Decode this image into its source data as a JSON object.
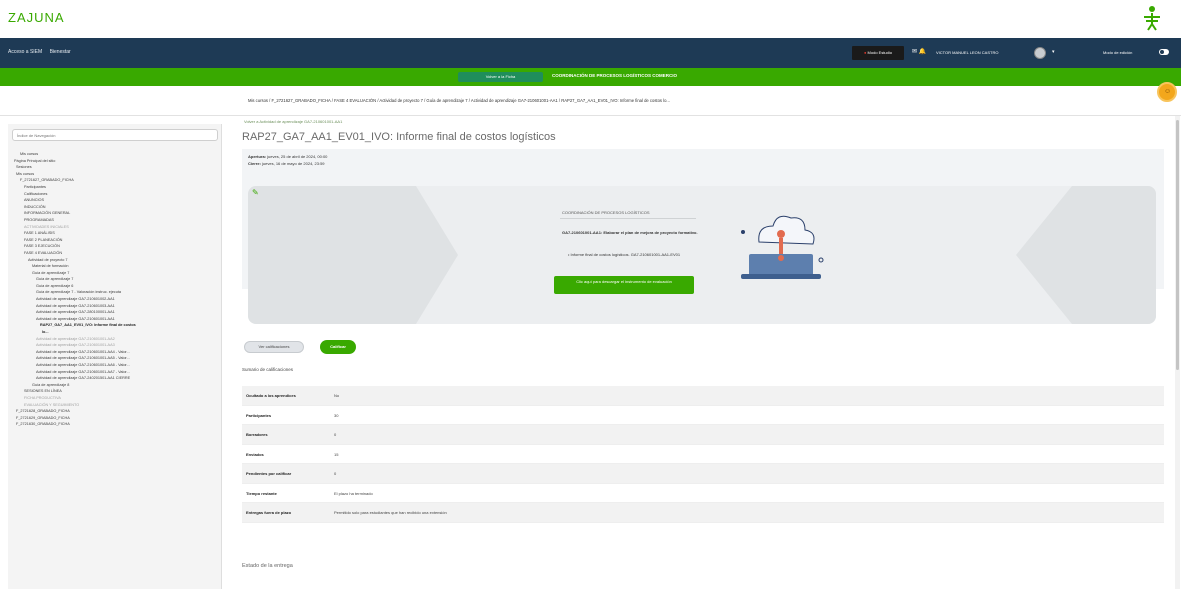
{
  "logo": {
    "text": "ZAJUNA"
  },
  "nav": {
    "left": [
      "Acceso a SIEM",
      "Bienestar"
    ],
    "red_button": "Modo Estudio",
    "user": "VICTOR MANUEL LEON CASTRO",
    "mode": "Modo de edición"
  },
  "green_bar": {
    "pill": "Volver a la Ficha",
    "title": "COORDINACIÓN DE PROCESOS LOGÍSTICOS COMERCIO"
  },
  "breadcrumb": "Mis cursos / F_2721627_GRABADO_FICHA / FASE 4 EVALUACIÓN / Actividad de proyecto 7 / Guía de aprendizaje 7 / Actividad de aprendizaje GA7-210601001-AA1 / RAP27_GA7_AA1_EV01_IVO: Informe final de costos lo...",
  "sidebar": {
    "search_placeholder": "Índice de Navegación",
    "tree": [
      {
        "text": "Mis cursos",
        "style": ""
      },
      {
        "text": "Página Principal del sitio",
        "style": ""
      },
      {
        "text": "Sesiones",
        "style": ""
      },
      {
        "text": "Mis cursos",
        "style": ""
      },
      {
        "text": "F_2721627_GRABADO_FICHA",
        "style": ""
      },
      {
        "text": "Participantes",
        "style": ""
      },
      {
        "text": "Calificaciones",
        "style": ""
      },
      {
        "text": "ANUNCIOS",
        "style": ""
      },
      {
        "text": "INDUCCIÓN",
        "style": ""
      },
      {
        "text": "INFORMACIÓN GENERAL",
        "style": ""
      },
      {
        "text": "PROGRAMADAS",
        "style": ""
      },
      {
        "text": "ACTIVIDADES INICIALES",
        "style": "muted"
      },
      {
        "text": "FASE 1 ANÁLISIS",
        "style": ""
      },
      {
        "text": "FASE 2 PLANEACIÓN",
        "style": ""
      },
      {
        "text": "FASE 3 EJECUCIÓN",
        "style": ""
      },
      {
        "text": "FASE 4 EVALUACIÓN",
        "style": ""
      },
      {
        "text": "Actividad de proyecto 7",
        "style": ""
      },
      {
        "text": "Material de formación",
        "style": ""
      },
      {
        "text": "Guía de aprendizaje 7",
        "style": ""
      },
      {
        "text": "Guía de aprendizaje 7",
        "style": ""
      },
      {
        "text": "Guía de aprendizaje 6",
        "style": ""
      },
      {
        "text": "Guía de aprendizaje 7 - Valoración instruc. ejecuta",
        "style": ""
      },
      {
        "text": "Actividad de aprendizaje GA7-210601002-AA1",
        "style": ""
      },
      {
        "text": "Actividad de aprendizaje GA7-210601003-AA1",
        "style": ""
      },
      {
        "text": "Actividad de aprendizaje GA7-280100001-AA1",
        "style": ""
      },
      {
        "text": "Actividad de aprendizaje GA7-210601001-AA1",
        "style": ""
      },
      {
        "text": "RAP27_GA7_AA1_EV01_IVO: Informe final de costos",
        "style": "bold"
      },
      {
        "text": "lo...",
        "style": "bold"
      },
      {
        "text": "Actividad de aprendizaje GA7-210601001-AA2",
        "style": "muted"
      },
      {
        "text": "Actividad de aprendizaje GA7-210601001-AA3",
        "style": "muted"
      },
      {
        "text": "Actividad de aprendizaje GA7-210601001-AA4 - Valor...",
        "style": ""
      },
      {
        "text": "Actividad de aprendizaje GA7-210601001-AA5 - Valor...",
        "style": ""
      },
      {
        "text": "Actividad de aprendizaje GA7-210601001-AA6 - Valor...",
        "style": ""
      },
      {
        "text": "Actividad de aprendizaje GA7-210601001-AA7 - Valor...",
        "style": ""
      },
      {
        "text": "Actividad de aprendizaje GA7-240201501-AA1 CIERRE",
        "style": ""
      },
      {
        "text": "Guía de aprendizaje 8",
        "style": ""
      },
      {
        "text": "SESIONES EN LÍNEA",
        "style": ""
      },
      {
        "text": "FICHA PRODUCTIVA",
        "style": "muted"
      },
      {
        "text": "EVALUACIÓN Y SEGUIMIENTO",
        "style": "muted"
      },
      {
        "text": "F_2721628_GRABADO_FICHA",
        "style": ""
      },
      {
        "text": "F_2721629_GRABADO_FICHA",
        "style": ""
      },
      {
        "text": "F_2721630_GRABADO_FICHA",
        "style": ""
      }
    ]
  },
  "main": {
    "back_link": "Volver a Actividad de aprendizaje GA7-210601001-AA1",
    "title": "RAP27_GA7_AA1_EV01_IVO: Informe final de costos logísticos",
    "opened_label": "Apertura:",
    "opened_value": "jueves, 25 de abril de 2024, 00:00",
    "due_label": "Cierre:",
    "due_value": "jueves, 16 de mayo de 2024, 23:59",
    "banner": {
      "heading": "COORDINACIÓN DE PROCESOS LOGÍSTICOS",
      "description": "GA7-210601001-AA1: Elaborar el plan de mejora de proyecto formativo.",
      "bullet": "Informe final de costos logísticos. GA7-210601001-AA1-EV01",
      "button": "Clic aquí para descargar el instrumento de evaluación"
    },
    "btn_grey": "Ver calificaciones",
    "btn_green": "Calificar",
    "summary_label": "Sumario de calificaciones",
    "table": [
      {
        "label": "Ocultado a los aprendices",
        "value": "No"
      },
      {
        "label": "Participantes",
        "value": "30"
      },
      {
        "label": "Borradores",
        "value": "0"
      },
      {
        "label": "Enviados",
        "value": "15"
      },
      {
        "label": "Pendientes por calificar",
        "value": "0"
      },
      {
        "label": "Tiempo restante",
        "value": "El plazo ha terminado"
      },
      {
        "label": "Entregas fuera de plazo",
        "value": "Permitido solo para estudiantes que han recibido una extensión"
      }
    ],
    "estado": "Estado de la entrega"
  },
  "colors": {
    "nav": "#1e3a55",
    "green": "#39a900",
    "orange": "#f3a71c"
  }
}
